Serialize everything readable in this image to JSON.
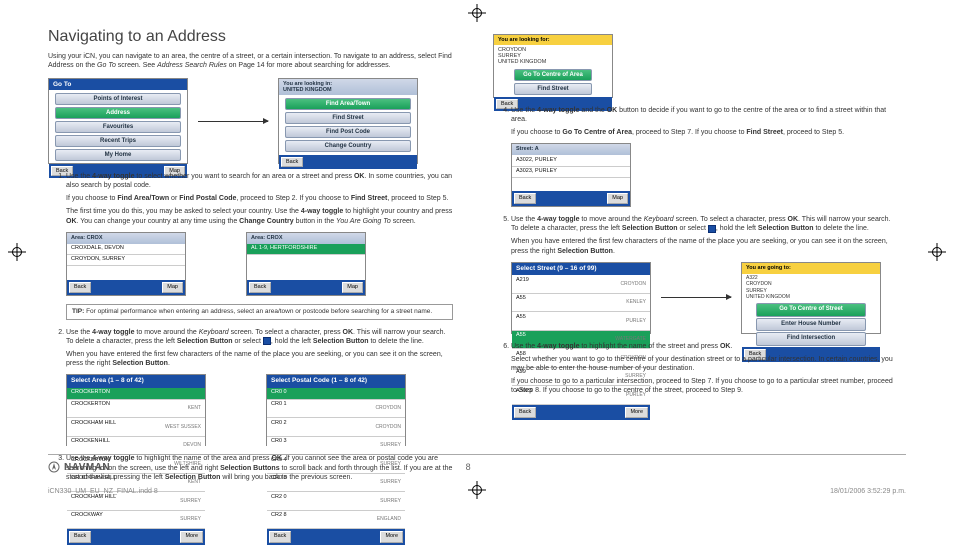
{
  "title": "Navigating to an Address",
  "intro_a": "Using your iCN, you can navigate to an area, the centre of a street, or a certain intersection. To navigate to an address, select Find Address on the ",
  "intro_b": "Go To",
  "intro_c": " screen. See ",
  "intro_d": "Address Search Rules",
  "intro_e": " on Page 14 for more about searching for addresses.",
  "scr_goto": {
    "hdr": "Go To",
    "items": [
      "Points of Interest",
      "Address",
      "Favourites",
      "Recent Trips",
      "My Home"
    ],
    "back": "Back",
    "map": "Map"
  },
  "scr_country": {
    "stripe": "You are looking in:",
    "val": "UNITED KINGDOM",
    "items": [
      "Find Area/Town",
      "Find Street",
      "Find Post Code",
      "Change Country"
    ],
    "back": "Back"
  },
  "step1": {
    "a": "Use the ",
    "b": "4-way toggle",
    "c": " to select whether you want to search for an area or a street and press ",
    "d": "OK",
    "e": ". In some countries, you can also search by postal code.",
    "sub1a": "If you choose to ",
    "sub1b": "Find Area/Town",
    "sub1c": " or ",
    "sub1d": "Find Postal Code",
    "sub1e": ", proceed to Step 2. If you choose to ",
    "sub1f": "Find Street",
    "sub1g": ", proceed to Step 5.",
    "sub2a": "The first time you do this, you may be asked to select your country. Use the ",
    "sub2b": "4-way toggle",
    "sub2c": " to highlight your country and press ",
    "sub2d": "OK",
    "sub2e": ". You can change your country at any time using the ",
    "sub2f": "Change Country",
    "sub2g": " button in the ",
    "sub2h": "You Are Going To",
    "sub2i": " screen."
  },
  "scr_kb1": {
    "stripe": "Area:",
    "val": "CROX",
    "rows": [
      "CROXDALE, DEVON",
      "CROYDON, SURREY"
    ],
    "back": "Back",
    "map": "Map"
  },
  "scr_kb2": {
    "stripe": "Area:",
    "val": "CROX",
    "rows": [
      "AL 1-9, HERTFORDSHIRE"
    ],
    "back": "Back",
    "map": "Map"
  },
  "tip_label": "TIP:",
  "tip": " For optimal performance when entering an address, select an area/town or postcode before searching for a street name.",
  "step2": {
    "a": "Use the ",
    "b": "4-way toggle",
    "c": " to move around the ",
    "d": "Keyboard",
    "e": " screen. To select a character, press ",
    "f": "OK",
    "g": ". This will narrow your search. To delete a character, press the left ",
    "h": "Selection Button",
    "i": " or select ",
    "j": ", hold the left ",
    "k": "Selection Button",
    "l": " to delete the line.",
    "sub_a": "When you have entered the first few characters of the name of the place you are seeking, or you can see it on the screen, press the right ",
    "sub_b": "Selection Button",
    "sub_c": "."
  },
  "scr_area": {
    "hdr": "Select Area (1 – 8 of 42)",
    "rows": [
      [
        "CROCKERTON",
        ""
      ],
      [
        "CROCKERTON",
        "KENT"
      ],
      [
        "CROCKHAM HILL",
        "WEST SUSSEX"
      ],
      [
        "CROCKENHILL",
        "DEVON"
      ],
      [
        "CROCKERTON",
        "WILTSHIRE"
      ],
      [
        "CROCKHAM HILL",
        "KENT"
      ],
      [
        "CROCKHAM HILL",
        "SURREY"
      ],
      [
        "CROCKWAY",
        "SURREY"
      ]
    ],
    "back": "Back",
    "more": "More"
  },
  "scr_post": {
    "hdr": "Select Postal Code (1 – 8 of 42)",
    "rows": [
      [
        "CR0 0",
        ""
      ],
      [
        "CR0 1",
        "CROYDON"
      ],
      [
        "CR0 2",
        "CROYDON"
      ],
      [
        "CR0 3",
        "SURREY"
      ],
      [
        "CR0 4",
        "SURREY"
      ],
      [
        "CR0 8",
        "SURREY"
      ],
      [
        "CR2 0",
        "SURREY"
      ],
      [
        "CR2 8",
        "ENGLAND"
      ]
    ],
    "back": "Back",
    "more": "More"
  },
  "step3": {
    "a": "Use the ",
    "b": "4-way toggle",
    "c": " to highlight the name of the area and press ",
    "d": "OK",
    "e": ". If you cannot see the area or postal code you are searching for on the screen, use the left and right ",
    "f": "Selection Buttons",
    "g": " to scroll back and forth through the list. If you are at the start of the list, pressing the left ",
    "h": "Selection Button",
    "i": " will bring you back to the previous screen."
  },
  "scr_centre": {
    "stripe": "You are looking for:",
    "lines": [
      "CROYDON",
      "SURREY",
      "UNITED KINGDOM"
    ],
    "btns": [
      "Go To Centre of Area",
      "Find Street"
    ],
    "back": "Back"
  },
  "step4": {
    "a": "Use the ",
    "b": "4-way toggle",
    "c": " and the ",
    "d": "OK",
    "e": " button to decide if you want to go to the centre of the area or to find a street within that area.",
    "sub_a": "If you choose to ",
    "sub_b": "Go To Centre of Area",
    "sub_c": ", proceed to Step 7. If you choose to ",
    "sub_d": "Find Street",
    "sub_e": ", proceed to Step 5."
  },
  "scr_kb3": {
    "stripe": "Street:",
    "val": "A",
    "rows": [
      "A3022, PURLEY",
      "A3023, PURLEY"
    ],
    "back": "Back",
    "map": "Map"
  },
  "step5": {
    "a": "Use the ",
    "b": "4-way toggle",
    "c": " to move around the ",
    "d": "Keyboard",
    "e": " screen. To select a character, press ",
    "f": "OK",
    "g": ". This will narrow your search. To delete a character, press the left ",
    "h": "Selection Button",
    "i": " or select ",
    "j": ", hold the left ",
    "k": "Selection Button",
    "l": " to delete the line.",
    "sub_a": "When you have entered the first few characters of the name of the place you are seeking, or you can see it on the screen, press the right ",
    "sub_b": "Selection Button",
    "sub_c": "."
  },
  "scr_street": {
    "hdr": "Select Street (9 – 16 of 99)",
    "rows": [
      [
        "A219",
        "CROYDON"
      ],
      [
        "A55",
        "KENLEY"
      ],
      [
        "A55",
        "PURLEY"
      ],
      [
        "A55",
        "WATERGATE"
      ],
      [
        "A58",
        "CROYDON"
      ],
      [
        "A59",
        "SURREY"
      ],
      [
        "A3023",
        "PURLEY"
      ]
    ],
    "back": "Back",
    "more": "More"
  },
  "scr_final": {
    "stripe": "You are going to:",
    "lines": [
      "A322",
      "CROYDON",
      "SURREY",
      "UNITED KINGDOM"
    ],
    "btns": [
      "Go To Centre of Street",
      "Enter House Number",
      "Find Intersection"
    ],
    "back": "Back"
  },
  "step6": {
    "a": "Use the ",
    "b": "4-way toggle",
    "c": " to highlight the name of the street and press ",
    "d": "OK",
    "e": ".",
    "sub1": "Select whether you want to go to the centre of your destination street or to a particular intersection. In certain countries, you may be able to enter the house number of your destination.",
    "sub2": "If you choose to go to a particular intersection, proceed to Step 7. If you choose to go to a particular street number, proceed to Step 8. If you choose to go to the centre of the street, proceed to Step 9."
  },
  "footer": {
    "brand": "NAVMAN",
    "page": "8"
  },
  "meta": {
    "file": "iCN330_UM_EU_NZ_FINAL.indd   8",
    "stamp": "18/01/2006   3:52:29 p.m."
  }
}
